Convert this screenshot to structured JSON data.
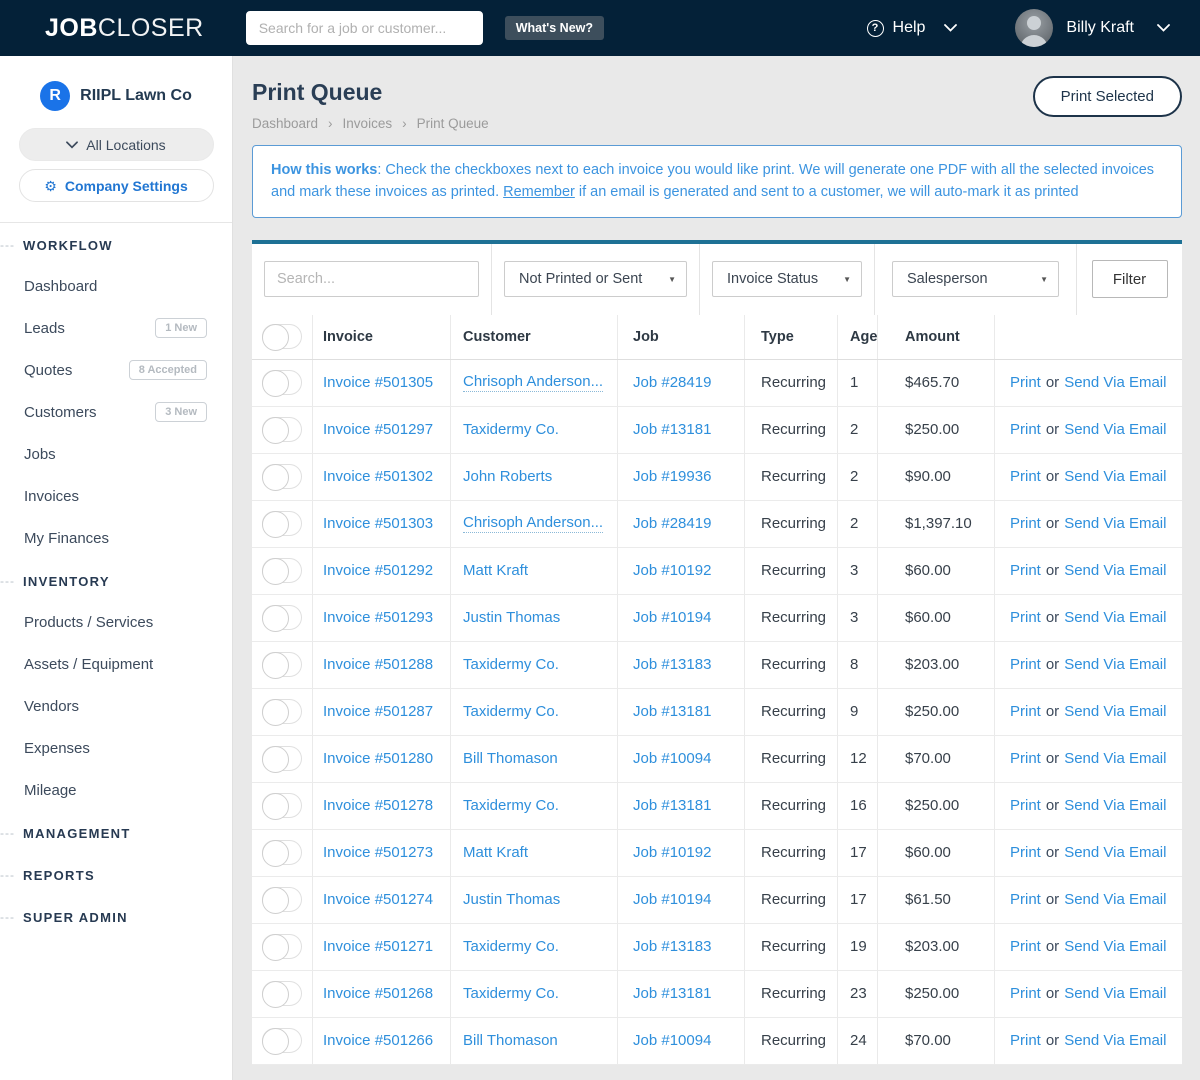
{
  "colors": {
    "navbar_bg": "#042138",
    "card_accent_teal": "#1e7195",
    "link_blue": "#2e8fdc",
    "info_blue": "#3c94e0",
    "brand_blue": "#1a73e8",
    "dark_navy": "#1d3349"
  },
  "icons": {
    "gear": "⚙",
    "help_q": "?",
    "select_arrow": "▼",
    "section_dashes": "---"
  },
  "navbar": {
    "logo_bold": "JOB",
    "logo_light": "CLOSER",
    "search_placeholder": "Search for a job or customer...",
    "whats_new_label": "What's New?",
    "help_label": "Help",
    "user_name": "Billy Kraft"
  },
  "sidebar": {
    "company": {
      "initial": "R",
      "name": "RIIPL Lawn Co"
    },
    "locations_label": "All Locations",
    "company_settings_label": "Company Settings",
    "sections": [
      {
        "label": "WORKFLOW",
        "items": [
          {
            "label": "Dashboard",
            "badge": ""
          },
          {
            "label": "Leads",
            "badge": "1 New"
          },
          {
            "label": "Quotes",
            "badge": "8 Accepted"
          },
          {
            "label": "Customers",
            "badge": "3 New"
          },
          {
            "label": "Jobs",
            "badge": ""
          },
          {
            "label": "Invoices",
            "badge": ""
          },
          {
            "label": "My Finances",
            "badge": ""
          }
        ]
      },
      {
        "label": "INVENTORY",
        "items": [
          {
            "label": "Products / Services",
            "badge": ""
          },
          {
            "label": "Assets / Equipment",
            "badge": ""
          },
          {
            "label": "Vendors",
            "badge": ""
          },
          {
            "label": "Expenses",
            "badge": ""
          },
          {
            "label": "Mileage",
            "badge": ""
          }
        ]
      },
      {
        "label": "MANAGEMENT",
        "items": []
      },
      {
        "label": "REPORTS",
        "items": []
      },
      {
        "label": "SUPER ADMIN",
        "items": []
      }
    ]
  },
  "page": {
    "title": "Print Queue",
    "breadcrumb": [
      "Dashboard",
      "Invoices",
      "Print Queue"
    ],
    "print_selected_label": "Print Selected",
    "info": {
      "bold": "How this works",
      "text1": ": Check the checkboxes next to each invoice you would like print. We will generate one PDF with all the selected invoices and mark these invoices as printed. ",
      "underline": "Remember",
      "text2": " if an email is generated and sent to a customer, we will auto-mark it as printed"
    }
  },
  "filters": {
    "search_placeholder": "Search...",
    "dropdowns": [
      "Not Printed or Sent",
      "Invoice Status",
      "Salesperson"
    ],
    "filter_button_label": "Filter"
  },
  "table": {
    "headers": [
      "Invoice",
      "Customer",
      "Job",
      "Type",
      "Age",
      "Amount"
    ],
    "action": {
      "print": "Print",
      "or": "or",
      "email": "Send Via Email"
    },
    "rows": [
      {
        "invoice": "Invoice #501305",
        "customer": "Chrisoph Anderson...",
        "truncated": true,
        "job": "Job #28419",
        "type": "Recurring",
        "age": "1",
        "amount": "$465.70"
      },
      {
        "invoice": "Invoice #501297",
        "customer": "Taxidermy Co.",
        "truncated": false,
        "job": "Job #13181",
        "type": "Recurring",
        "age": "2",
        "amount": "$250.00"
      },
      {
        "invoice": "Invoice #501302",
        "customer": "John Roberts",
        "truncated": false,
        "job": "Job #19936",
        "type": "Recurring",
        "age": "2",
        "amount": "$90.00"
      },
      {
        "invoice": "Invoice #501303",
        "customer": "Chrisoph Anderson...",
        "truncated": true,
        "job": "Job #28419",
        "type": "Recurring",
        "age": "2",
        "amount": "$1,397.10"
      },
      {
        "invoice": "Invoice #501292",
        "customer": "Matt Kraft",
        "truncated": false,
        "job": "Job #10192",
        "type": "Recurring",
        "age": "3",
        "amount": "$60.00"
      },
      {
        "invoice": "Invoice #501293",
        "customer": "Justin Thomas",
        "truncated": false,
        "job": "Job #10194",
        "type": "Recurring",
        "age": "3",
        "amount": "$60.00"
      },
      {
        "invoice": "Invoice #501288",
        "customer": "Taxidermy Co.",
        "truncated": false,
        "job": "Job #13183",
        "type": "Recurring",
        "age": "8",
        "amount": "$203.00"
      },
      {
        "invoice": "Invoice #501287",
        "customer": "Taxidermy Co.",
        "truncated": false,
        "job": "Job #13181",
        "type": "Recurring",
        "age": "9",
        "amount": "$250.00"
      },
      {
        "invoice": "Invoice #501280",
        "customer": "Bill Thomason",
        "truncated": false,
        "job": "Job #10094",
        "type": "Recurring",
        "age": "12",
        "amount": "$70.00"
      },
      {
        "invoice": "Invoice #501278",
        "customer": "Taxidermy Co.",
        "truncated": false,
        "job": "Job #13181",
        "type": "Recurring",
        "age": "16",
        "amount": "$250.00"
      },
      {
        "invoice": "Invoice #501273",
        "customer": "Matt Kraft",
        "truncated": false,
        "job": "Job #10192",
        "type": "Recurring",
        "age": "17",
        "amount": "$60.00"
      },
      {
        "invoice": "Invoice #501274",
        "customer": "Justin Thomas",
        "truncated": false,
        "job": "Job #10194",
        "type": "Recurring",
        "age": "17",
        "amount": "$61.50"
      },
      {
        "invoice": "Invoice #501271",
        "customer": "Taxidermy Co.",
        "truncated": false,
        "job": "Job #13183",
        "type": "Recurring",
        "age": "19",
        "amount": "$203.00"
      },
      {
        "invoice": "Invoice #501268",
        "customer": "Taxidermy Co.",
        "truncated": false,
        "job": "Job #13181",
        "type": "Recurring",
        "age": "23",
        "amount": "$250.00"
      },
      {
        "invoice": "Invoice #501266",
        "customer": "Bill Thomason",
        "truncated": false,
        "job": "Job #10094",
        "type": "Recurring",
        "age": "24",
        "amount": "$70.00"
      }
    ]
  }
}
